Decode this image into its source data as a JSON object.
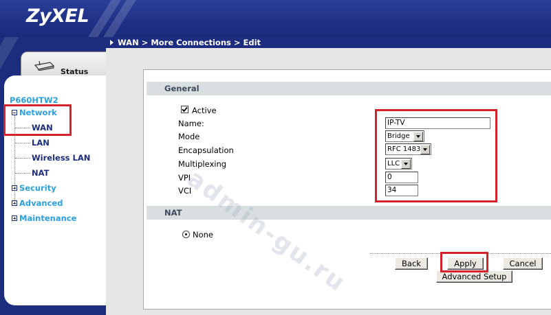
{
  "brand": {
    "logo_text": "ZyXEL"
  },
  "breadcrumb": {
    "text": "WAN > More Connections > Edit"
  },
  "sidebar": {
    "status_tab": "Status",
    "model": "P660HTW2",
    "network": "Network",
    "wan": "WAN",
    "lan": "LAN",
    "wireless_lan": "Wireless LAN",
    "nat": "NAT",
    "security": "Security",
    "advanced": "Advanced",
    "maintenance": "Maintenance"
  },
  "general": {
    "section_title": "General",
    "active_label": "Active",
    "active_checked": true,
    "name_label": "Name:",
    "name_value": "IP-TV",
    "mode_label": "Mode",
    "mode_value": "Bridge",
    "encapsulation_label": "Encapsulation",
    "encapsulation_value": "RFC 1483",
    "multiplexing_label": "Multiplexing",
    "multiplexing_value": "LLC",
    "vpi_label": "VPI",
    "vpi_value": "0",
    "vci_label": "VCI",
    "vci_value": "34"
  },
  "nat": {
    "section_title": "NAT",
    "none_label": "None",
    "none_selected": true
  },
  "buttons": {
    "back": "Back",
    "apply": "Apply",
    "cancel": "Cancel",
    "advanced_setup": "Advanced Setup"
  },
  "watermark": "admin-gu.ru",
  "colors": {
    "header_blue": "#1f3186",
    "menu_accent": "#2aa0e0",
    "highlight_red": "#d4212b",
    "section_bar": "#d9dfe1"
  }
}
